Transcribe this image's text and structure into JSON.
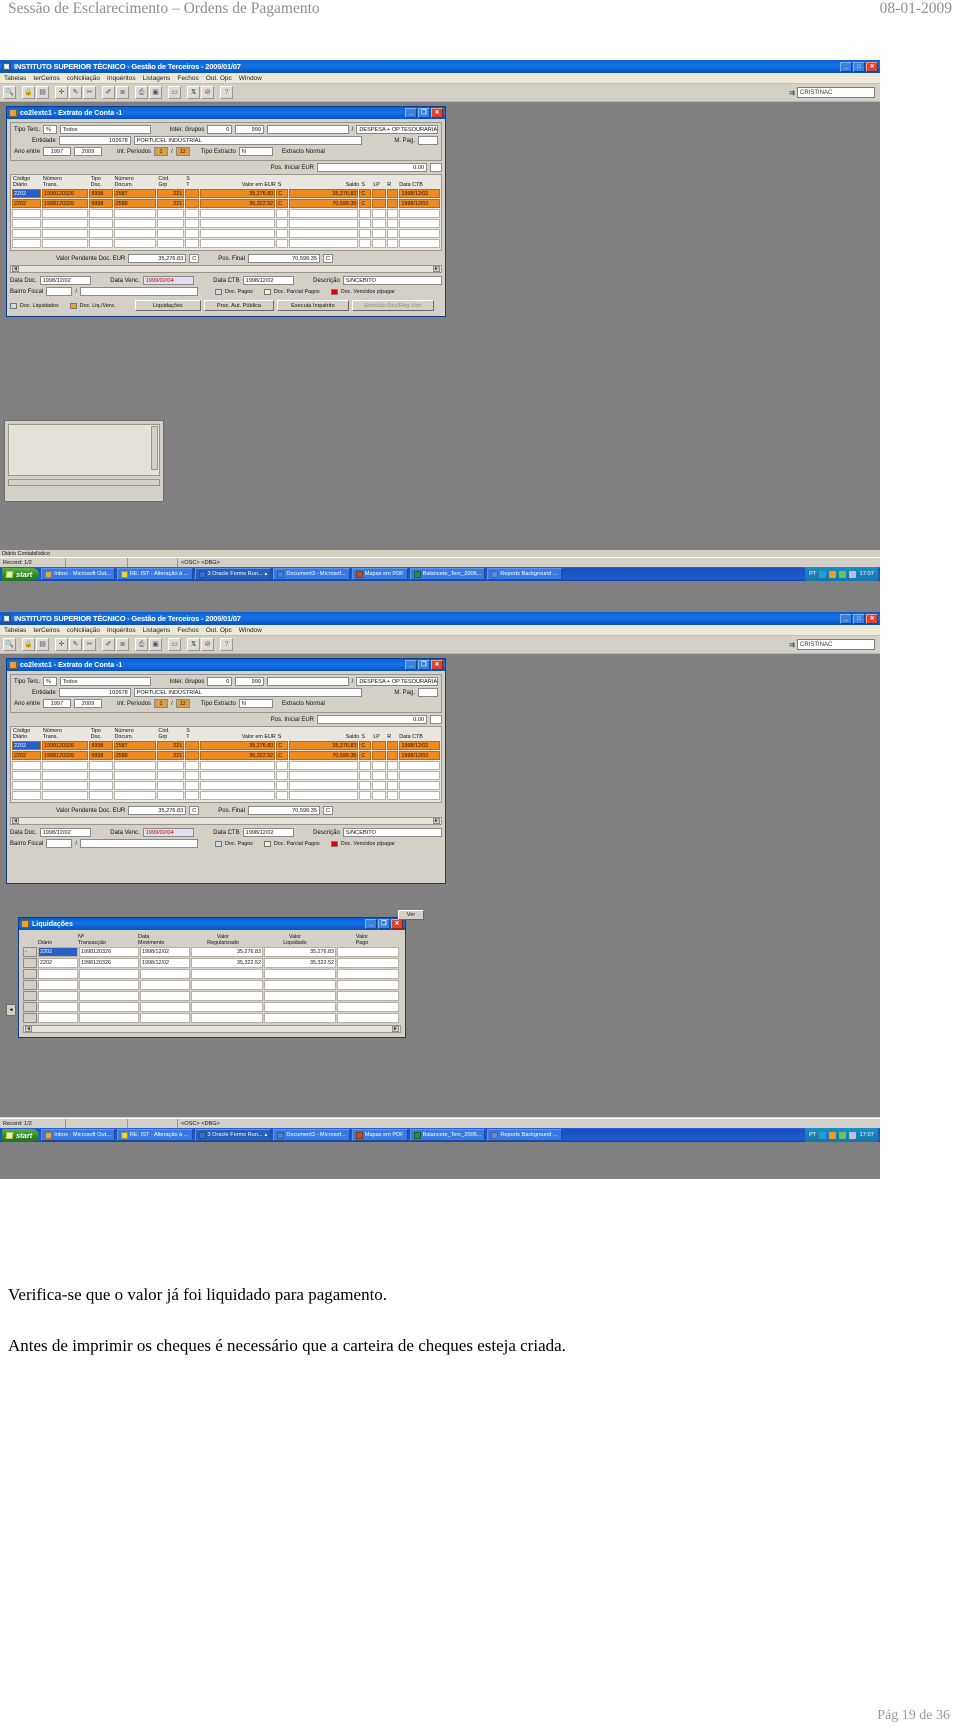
{
  "document": {
    "header_title": "Sessão de Esclarecimento – Ordens de Pagamento",
    "header_date": "08-01-2009",
    "paragraph_1": "Verifica-se que o valor já foi liquidado para pagamento.",
    "paragraph_2": "Antes de imprimir os cheques é necessário que a carteira de cheques esteja criada.",
    "footer": "Pág 19 de 36"
  },
  "app": {
    "title": "INSTITUTO SUPERIOR TÉCNICO  -  Gestão de Terceiros  -  2009/01/07",
    "title_icon": "oracle-forms-icon",
    "minimize": "_",
    "maximize": "□",
    "close": "✕",
    "menu": [
      "Tabelas",
      "terCeiros",
      "coNciliação",
      "Inquéritos",
      "Listagens",
      "Fechos",
      "Out. Opc",
      "Window"
    ],
    "toolbar_icons": [
      "search-icon",
      "lock-icon",
      "save-icon",
      "insert-record-icon",
      "remove-record-icon",
      "cut-icon",
      "edit-icon",
      "list-icon",
      "print-icon",
      "copy-icon",
      "window-icon",
      "excel-export-icon",
      "clear-icon",
      "help-icon"
    ],
    "user_field_label": "export-icon",
    "user_value": "CRISTINAC"
  },
  "form": {
    "title": "co2lextc1  -  Extrato de Conta -1",
    "title_icon": "form-window-icon",
    "minimize": "_",
    "restore": "❐",
    "close": "✕",
    "filters": {
      "tipo_terc_label": "Tipo Terc.",
      "tipo_terc_code": "%",
      "tipo_terc_desc": "Todos",
      "inter_grupos_label": "Inter. Grupos",
      "inter_grupos_from": "0",
      "inter_grupos_to": "999",
      "grupo_desc": "",
      "slash": "/",
      "tipo_extracto_desc_top": "DESPESA + OP.TESOURARIA IN",
      "mpag_label": "M. Pag.",
      "entidade_label": "Entidade",
      "entidade_code": "102678",
      "entidade_nome": "PORTUCEL INDUSTRIAL",
      "ano_entre_label": "Ano entre",
      "ano_de": "1997",
      "ano_ate": "2009",
      "int_periodos_label": "Int. Períodos",
      "periodo_de": "1",
      "periodo_sep": "/",
      "periodo_ate": "12",
      "tipo_extracto_label": "Tipo Extracto",
      "tipo_extracto_code": "N",
      "tipo_extracto_desc": "Extracto Normal",
      "pos_inicial_label": "Pos. Inicial EUR",
      "pos_inicial_value": "0.00"
    },
    "grid_headers": [
      "Código\nDiário",
      "Número\nTrans.",
      "Tipo\nDoc.",
      "Número\nDocum.",
      "Cód.\nGrp",
      "S\nT",
      "Valor em EUR",
      "S",
      "Saldo",
      "S",
      "LP",
      "R",
      "Data CTB"
    ],
    "grid_header_parts": {
      "codigo_diario": [
        "Código",
        "Diário"
      ],
      "numero_trans": [
        "Número",
        "Trans."
      ],
      "tipo_doc": [
        "Tipo",
        "Doc."
      ],
      "numero_docum": [
        "Número",
        "Docum."
      ],
      "cod_grp": [
        "Cód.",
        "Grp"
      ],
      "st": [
        "S",
        "T"
      ],
      "valor_eur": [
        "",
        "Valor em EUR"
      ],
      "s1": [
        "",
        "S"
      ],
      "saldo": [
        "",
        "Saldo"
      ],
      "s2": [
        "",
        "S"
      ],
      "lp": [
        "",
        "LP"
      ],
      "r": [
        "",
        "R"
      ],
      "data_ctb": [
        "",
        "Data CTB"
      ]
    },
    "rows": [
      {
        "diario": "2202",
        "trans": "1998120326",
        "tipo_doc": "9998",
        "num_doc": "2587",
        "grp": "221",
        "st": "",
        "valor": "35,276.83",
        "s1": "C",
        "saldo": "35,276.83",
        "s2": "C",
        "lp": "",
        "r": "",
        "data_ctb": "1998/12/02",
        "selected": true
      },
      {
        "diario": "2202",
        "trans": "1998120326",
        "tipo_doc": "9998",
        "num_doc": "2588",
        "grp": "221",
        "st": "",
        "valor": "35,322.52",
        "s1": "C",
        "saldo": "70,599.35",
        "s2": "C",
        "lp": "",
        "r": "",
        "data_ctb": "1998/12/02",
        "selected": false
      }
    ],
    "totals": {
      "valor_pendente_label": "Valor Pendente Doc. EUR",
      "valor_pendente": "35,276.83",
      "valor_pendente_s": "C",
      "pos_final_label": "Pos. Final",
      "pos_final": "70,599.35",
      "pos_final_s": "C"
    },
    "detail": {
      "data_doc_label": "Data Doc.",
      "data_doc": "1998/12/02",
      "data_venc_label": "Data Venc.",
      "data_venc": "1999/02/04",
      "data_ctb_label": "Data CTB",
      "data_ctb": "1998/12/02",
      "descricao_label": "Descrição",
      "descricao": "S/NCEBITO",
      "bairro_fiscal_label": "Bairro Fiscal",
      "bairro_fiscal": "",
      "bairro_sep": "/",
      "bairro_desc": ""
    },
    "legend": [
      {
        "label": "Doc. Pagos",
        "color": "#c8e0ec"
      },
      {
        "label": "Doc. Parcial Pagos",
        "color": "#f4f0c0"
      },
      {
        "label": "Doc. Vencidos p/pagar",
        "color": "#e00000"
      }
    ],
    "legend2": [
      {
        "label": "Doc. Liquidados",
        "color": "#c8e0ec"
      },
      {
        "label": "Doc. Liq./Venc.",
        "color": "#e8a33d"
      }
    ],
    "buttons": [
      "Liquidações",
      "Proc. Aut. Pública",
      "Executa Inquérito",
      "Emissão Dec/Reg.Vizir"
    ]
  },
  "dialog": {
    "title": "Liquidações",
    "title_icon": "form-window-icon",
    "minimize": "_",
    "restore": "❐",
    "close": "✕",
    "headers": {
      "diario": [
        "",
        "Diário"
      ],
      "transaccao": [
        "Nº",
        "Transacção"
      ],
      "data_mov": [
        "Data",
        "Movimento"
      ],
      "valor_reg": [
        "Valor",
        "Regularizado"
      ],
      "valor_liq": [
        "Valor",
        "Liquidado"
      ],
      "valor_pago": [
        "Valor",
        "Pago"
      ]
    },
    "rows": [
      {
        "diario": "2202",
        "transaccao": "1998120326",
        "data_mov": "1998/12/02",
        "valor_reg": "35,276.83",
        "valor_liq": "35,276.83",
        "valor_pago": "",
        "selected": true
      },
      {
        "diario": "2202",
        "transaccao": "1998120326",
        "data_mov": "1998/12/02",
        "valor_reg": "35,322.52",
        "valor_liq": "35,322.52",
        "valor_pago": "",
        "selected": false
      }
    ],
    "side_button": "Ver"
  },
  "status_bar": {
    "record": "Record: 1/2",
    "field2": "",
    "field3": "",
    "modes": "<OSC> <DBG>"
  },
  "taskbar": {
    "start": "start",
    "items": [
      {
        "label": "Inbox - Microsoft Out...",
        "icon_color": "#e8a33d"
      },
      {
        "label": "RE: IST - Alteração à ...",
        "icon_color": "#e8d23d"
      },
      {
        "label": "3 Oracle Forms Run...",
        "icon_color": "#3a6fc4",
        "active": true
      },
      {
        "label": "Document3 - Microsof...",
        "icon_color": "#4a7fd0"
      },
      {
        "label": "Mapas em PDF",
        "icon_color": "#c05020"
      },
      {
        "label": "Balancete_Terc_2006...",
        "icon_color": "#2d8a4a"
      },
      {
        "label": "Reports Background ...",
        "icon_color": "#6a8ad0"
      }
    ],
    "tray_lang": "PT",
    "tray_icons": [
      "shield-icon",
      "volume-icon",
      "network-icon",
      "battery-icon"
    ],
    "clock": "17:07"
  }
}
